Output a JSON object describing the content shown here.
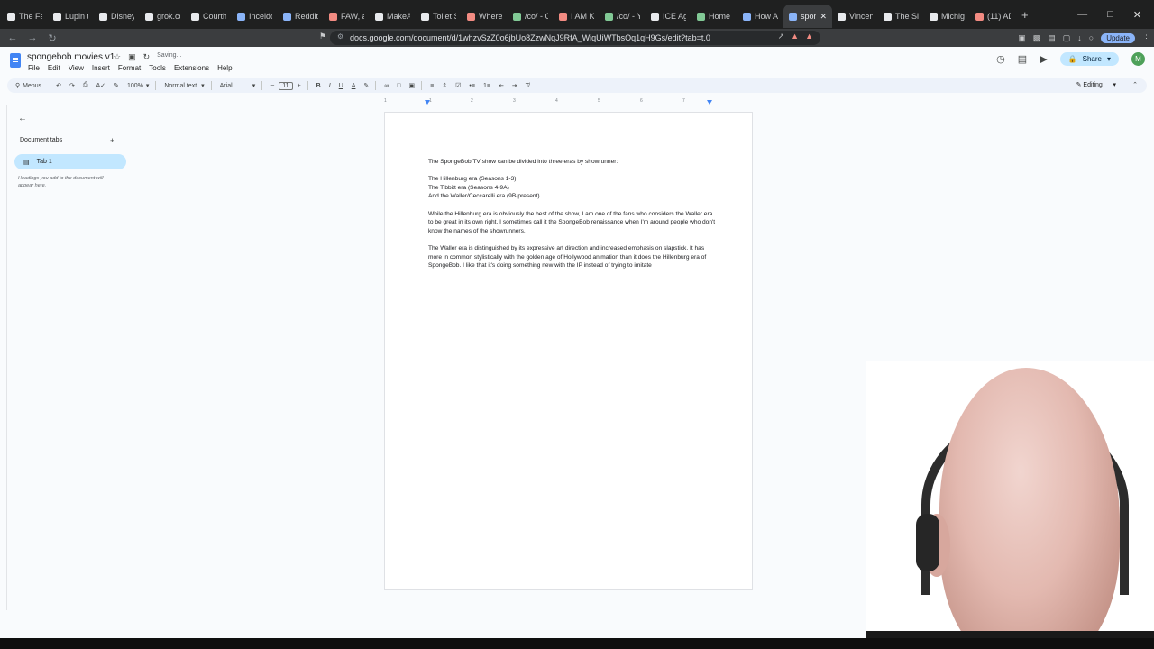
{
  "browser": {
    "tabs": [
      {
        "title": "The Fairly",
        "color": "#e8eaed"
      },
      {
        "title": "Lupin the",
        "color": "#e8eaed"
      },
      {
        "title": "Disney an",
        "color": "#e8eaed"
      },
      {
        "title": "grok.com",
        "color": "#e8eaed"
      },
      {
        "title": "Courthous",
        "color": "#e8eaed"
      },
      {
        "title": "Inceldom",
        "color": "#8ab4f8"
      },
      {
        "title": "Reddit - It",
        "color": "#8ab4f8"
      },
      {
        "title": "FAW, a wa",
        "color": "#f28b82"
      },
      {
        "title": "MakeAvan",
        "color": "#e8eaed"
      },
      {
        "title": "Toilet Seat",
        "color": "#e8eaed"
      },
      {
        "title": "Where did",
        "color": "#f28b82"
      },
      {
        "title": "/co/ - One",
        "color": "#81c995"
      },
      {
        "title": "I AM Kyle",
        "color": "#f28b82"
      },
      {
        "title": "/co/ - You",
        "color": "#81c995"
      },
      {
        "title": "ICE Agents",
        "color": "#e8eaed"
      },
      {
        "title": "Home - Gi",
        "color": "#81c995"
      },
      {
        "title": "How Adult",
        "color": "#8ab4f8"
      },
      {
        "title": "spong",
        "color": "#8ab4f8",
        "active": true
      },
      {
        "title": "Vincent W",
        "color": "#e8eaed"
      },
      {
        "title": "The Simps",
        "color": "#e8eaed"
      },
      {
        "title": "Michigan",
        "color": "#e8eaed"
      },
      {
        "title": "(11) ADGt",
        "color": "#f28b82"
      }
    ],
    "url": "docs.google.com/document/d/1whzvSzZ0o6jbUo8ZzwNqJ9RfA_WiqUiWTbsOq1qH9Gs/edit?tab=t.0",
    "update_label": "Update"
  },
  "doc": {
    "title": "spongebob movies v1",
    "saving": "Saving...",
    "menus": [
      "File",
      "Edit",
      "View",
      "Insert",
      "Format",
      "Tools",
      "Extensions",
      "Help"
    ],
    "share_label": "Share",
    "avatar_letter": "M"
  },
  "toolbar": {
    "menus_label": "Menus",
    "zoom": "100%",
    "style": "Normal text",
    "font": "Arial",
    "font_size": "11",
    "mode": "Editing"
  },
  "ruler": {
    "marks": [
      "1",
      "1",
      "2",
      "3",
      "4",
      "5",
      "6",
      "7"
    ]
  },
  "sidebar": {
    "heading": "Document tabs",
    "tab_label": "Tab 1",
    "hint": "Headings you add to the document will appear here."
  },
  "content": {
    "p1": "The SpongeBob TV show can be divided into three eras by showrunner:",
    "list": [
      "The Hillenburg era (Seasons 1-3)",
      "The Tibbitt era (Seasons 4-9A)",
      "And the Waller/Ceccarelli era (9B-present)"
    ],
    "p2": "While the Hillenburg era is obviously the best of the show, I am one of the fans who considers the Waller era to be great in its own right. I sometimes call it the SpongeBob renaissance when I'm around people who don't know the names of the showrunners.",
    "p3": "The Waller era is distinguished by its expressive art direction and increased emphasis on slapstick. It has more in common stylistically with the golden age of Hollywood animation than it does the Hillenburg era of SpongeBob. I like that it's doing something new with the IP instead of trying to imitate"
  }
}
